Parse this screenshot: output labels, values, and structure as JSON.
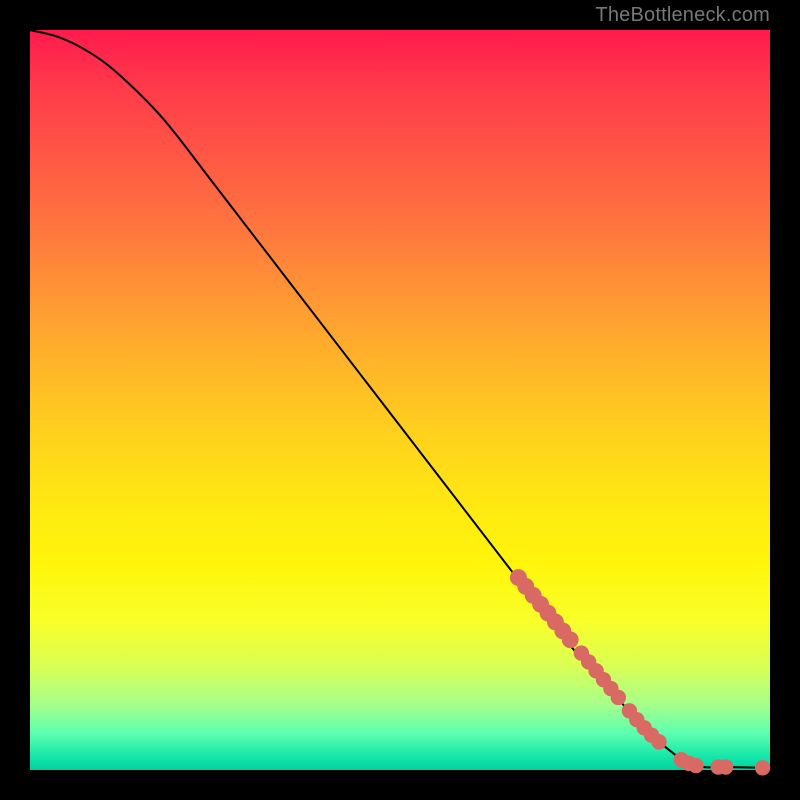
{
  "watermark": "TheBottleneck.com",
  "colors": {
    "marker": "#d86a63",
    "curve": "#000000",
    "frame": "#000000"
  },
  "chart_data": {
    "type": "line",
    "title": "",
    "xlabel": "",
    "ylabel": "",
    "xlim": [
      0,
      100
    ],
    "ylim": [
      0,
      100
    ],
    "curve": [
      {
        "x": 0,
        "y": 100
      },
      {
        "x": 4,
        "y": 99
      },
      {
        "x": 8,
        "y": 97
      },
      {
        "x": 12,
        "y": 94
      },
      {
        "x": 18,
        "y": 88
      },
      {
        "x": 25,
        "y": 79
      },
      {
        "x": 35,
        "y": 66
      },
      {
        "x": 45,
        "y": 53
      },
      {
        "x": 55,
        "y": 40
      },
      {
        "x": 65,
        "y": 27
      },
      {
        "x": 72,
        "y": 18
      },
      {
        "x": 80,
        "y": 9
      },
      {
        "x": 86,
        "y": 3
      },
      {
        "x": 90,
        "y": 0.6
      },
      {
        "x": 94,
        "y": 0.4
      },
      {
        "x": 100,
        "y": 0.3
      }
    ],
    "markers": [
      {
        "x": 66,
        "y": 26,
        "r": 1.2
      },
      {
        "x": 67,
        "y": 24.8,
        "r": 1.2
      },
      {
        "x": 68,
        "y": 23.6,
        "r": 1.2
      },
      {
        "x": 69,
        "y": 22.4,
        "r": 1.2
      },
      {
        "x": 70,
        "y": 21.2,
        "r": 1.2
      },
      {
        "x": 71,
        "y": 20,
        "r": 1.2
      },
      {
        "x": 72,
        "y": 18.8,
        "r": 1.2
      },
      {
        "x": 73,
        "y": 17.6,
        "r": 1.2
      },
      {
        "x": 74.5,
        "y": 15.8,
        "r": 1.0
      },
      {
        "x": 75.5,
        "y": 14.6,
        "r": 1.0
      },
      {
        "x": 76.5,
        "y": 13.4,
        "r": 1.0
      },
      {
        "x": 77.5,
        "y": 12.2,
        "r": 1.0
      },
      {
        "x": 78.5,
        "y": 11,
        "r": 1.0
      },
      {
        "x": 79.5,
        "y": 9.8,
        "r": 1.0
      },
      {
        "x": 81,
        "y": 8,
        "r": 1.0
      },
      {
        "x": 82,
        "y": 6.8,
        "r": 1.0
      },
      {
        "x": 83,
        "y": 5.7,
        "r": 1.0
      },
      {
        "x": 84,
        "y": 4.7,
        "r": 1.0
      },
      {
        "x": 85,
        "y": 3.8,
        "r": 1.0
      },
      {
        "x": 88,
        "y": 1.4,
        "r": 1.0
      },
      {
        "x": 89,
        "y": 0.9,
        "r": 1.0
      },
      {
        "x": 90,
        "y": 0.6,
        "r": 1.0
      },
      {
        "x": 93,
        "y": 0.4,
        "r": 1.0
      },
      {
        "x": 94,
        "y": 0.4,
        "r": 1.0
      },
      {
        "x": 99,
        "y": 0.3,
        "r": 1.0
      }
    ]
  }
}
